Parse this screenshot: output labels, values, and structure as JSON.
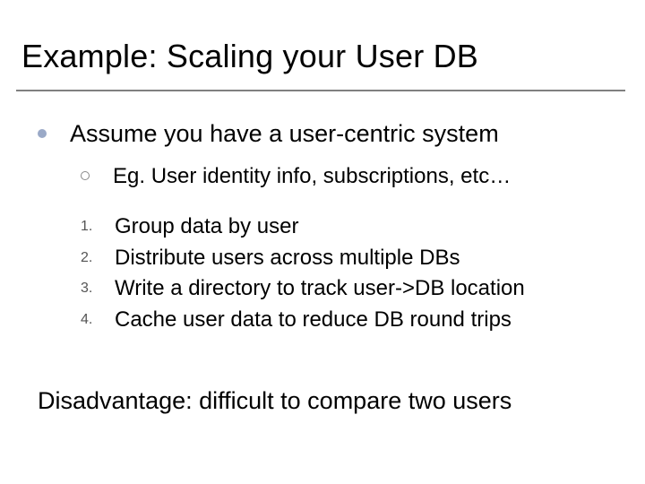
{
  "title": "Example: Scaling your User DB",
  "bullet1": "Assume you have a user-centric system",
  "sub1": "Eg. User identity info, subscriptions, etc…",
  "steps": {
    "n1": "1.",
    "t1": "Group data by user",
    "n2": "2.",
    "t2": "Distribute users across multiple DBs",
    "n3": "3.",
    "t3": "Write a directory to track user->DB location",
    "n4": "4.",
    "t4": "Cache user data to reduce DB round trips"
  },
  "closing": "Disadvantage: difficult to compare two users"
}
